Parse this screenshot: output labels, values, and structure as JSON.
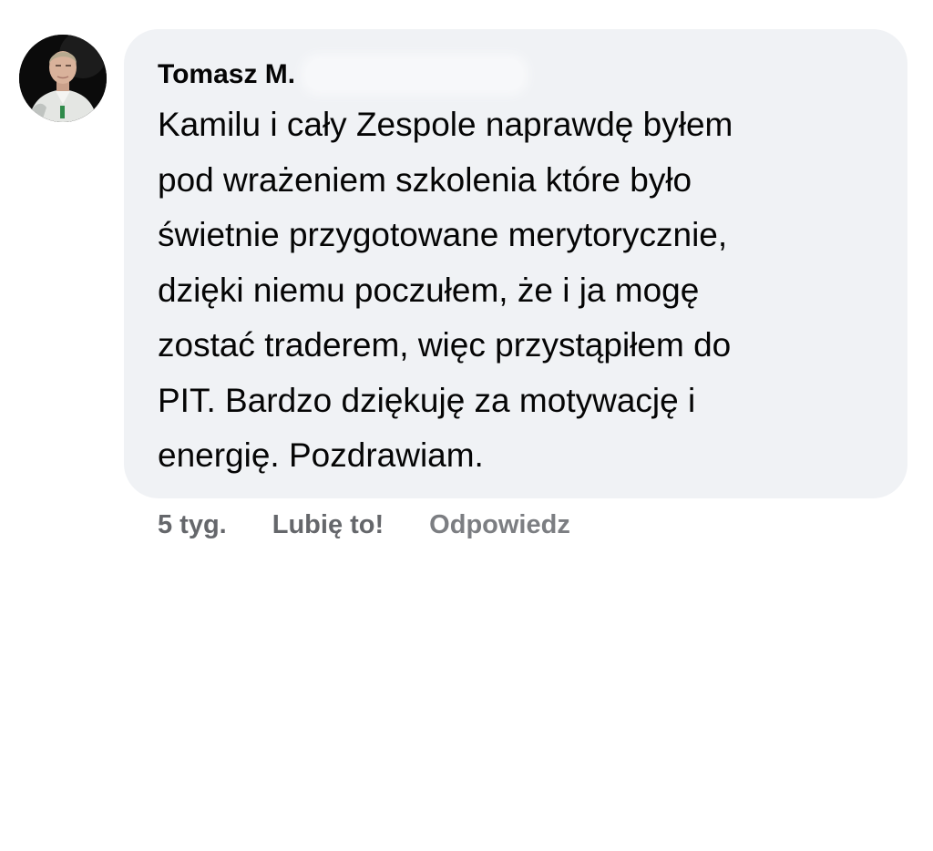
{
  "comment": {
    "author": "Tomasz M.",
    "avatar_icon": "user-avatar-photo",
    "text_lines": [
      "Kamilu i cały Zespole naprawdę byłem",
      "pod wrażeniem szkolenia które było",
      "świetnie przygotowane merytorycznie,",
      "dzięki niemu poczułem, że i ja mogę",
      "zostać traderem, więc przystąpiłem do",
      "PIT. Bardzo dziękuję za motywację i",
      "energię. Pozdrawiam."
    ],
    "timestamp": "5 tyg.",
    "like_label": "Lubię to!",
    "reply_label": "Odpowiedz"
  },
  "colors": {
    "bubble": "#f0f2f5",
    "text": "#050505",
    "secondary_text": "#65676b"
  }
}
